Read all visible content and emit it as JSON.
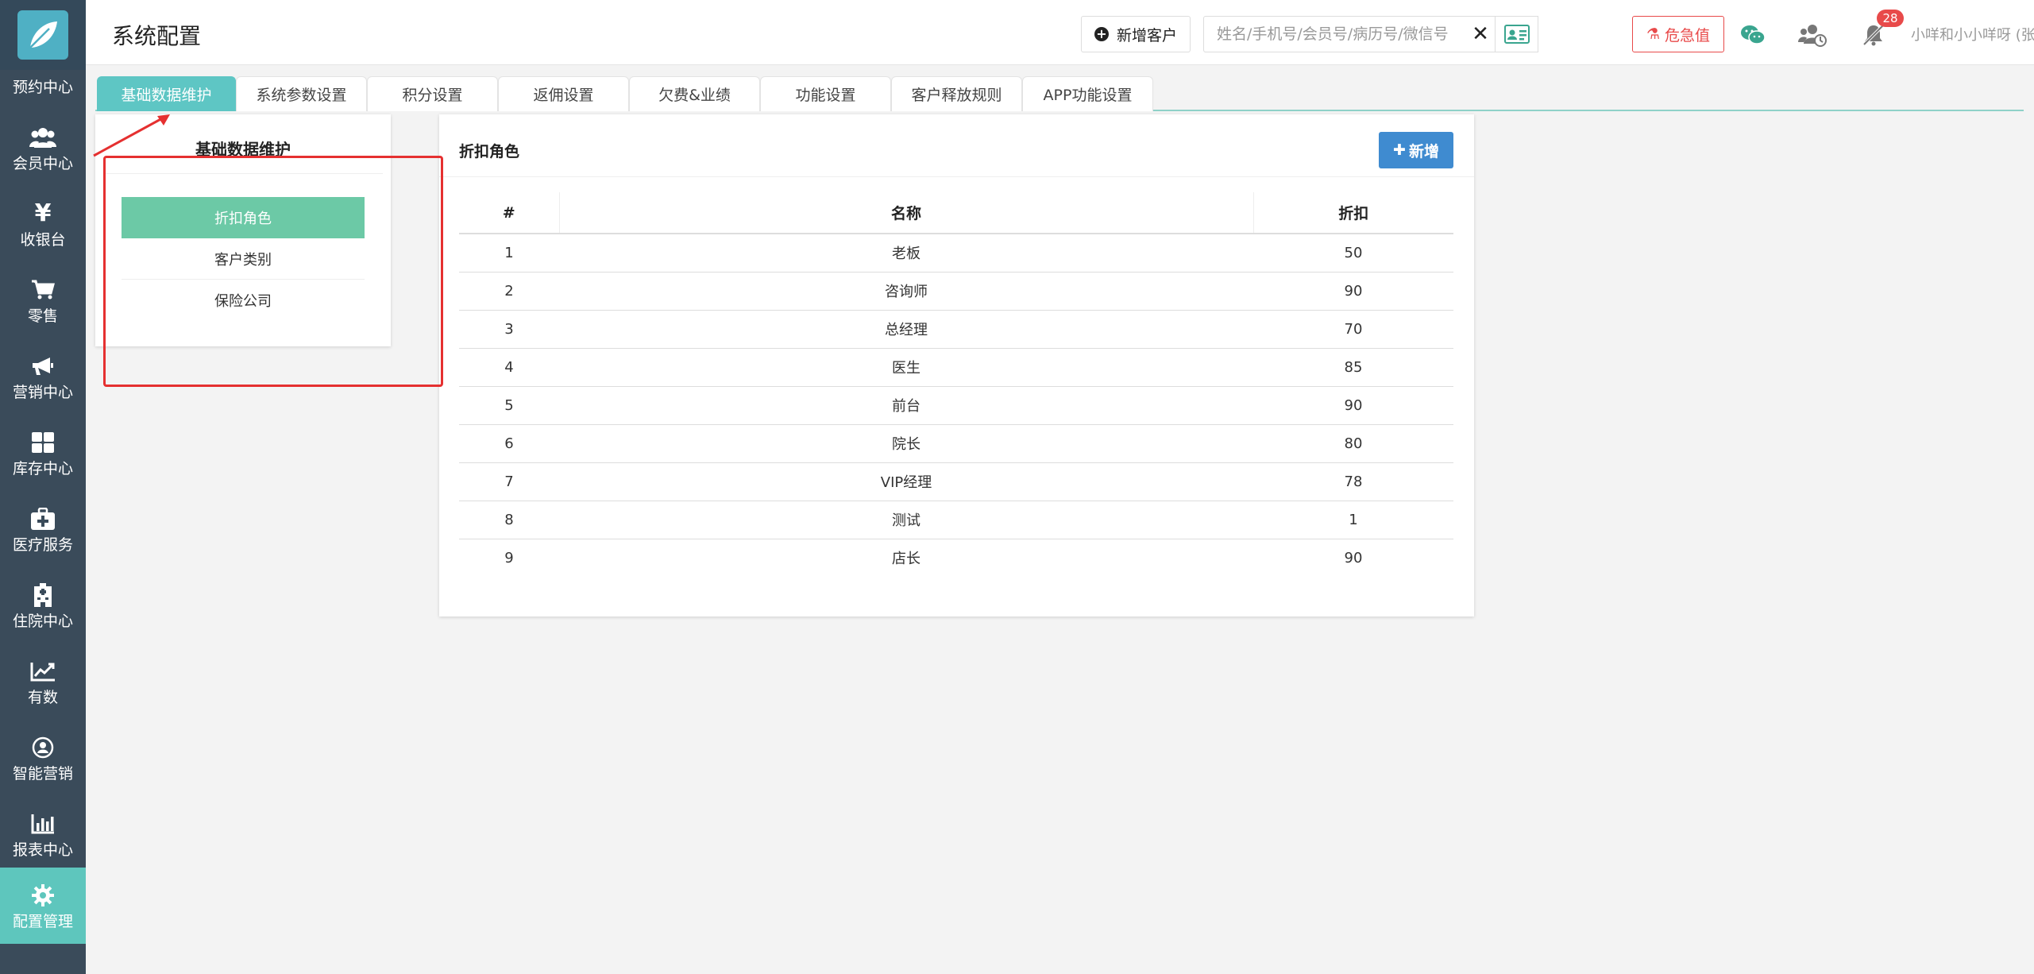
{
  "header": {
    "title": "系统配置",
    "add_customer_label": "新增客户",
    "search_placeholder": "姓名/手机号/会员号/病历号/微信号",
    "clear_icon": "close-icon",
    "danger_label": "危急值",
    "notification_count": "28",
    "user_name": "小咩和小小咩呀 (张江门诊部)"
  },
  "sidebar": {
    "partial_label": "预约中心",
    "items": [
      {
        "label": "会员中心",
        "icon": "users-icon"
      },
      {
        "label": "收银台",
        "icon": "yen-icon"
      },
      {
        "label": "零售",
        "icon": "cart-icon"
      },
      {
        "label": "营销中心",
        "icon": "megaphone-icon"
      },
      {
        "label": "库存中心",
        "icon": "grid-icon"
      },
      {
        "label": "医疗服务",
        "icon": "medkit-icon"
      },
      {
        "label": "住院中心",
        "icon": "hospital-icon"
      },
      {
        "label": "有数",
        "icon": "line-chart-icon"
      },
      {
        "label": "智能营销",
        "icon": "smart-marketing-icon"
      },
      {
        "label": "报表中心",
        "icon": "bar-chart-icon"
      },
      {
        "label": "配置管理",
        "icon": "gear-icon"
      }
    ]
  },
  "tabs": [
    {
      "label": "基础数据维护"
    },
    {
      "label": "系统参数设置"
    },
    {
      "label": "积分设置"
    },
    {
      "label": "返佣设置"
    },
    {
      "label": "欠费&业绩"
    },
    {
      "label": "功能设置"
    },
    {
      "label": "客户释放规则"
    },
    {
      "label": "APP功能设置"
    }
  ],
  "left_panel": {
    "title": "基础数据维护",
    "items": [
      {
        "label": "折扣角色"
      },
      {
        "label": "客户类别"
      },
      {
        "label": "保险公司"
      }
    ]
  },
  "right_panel": {
    "title": "折扣角色",
    "new_button_label": "新增",
    "columns": [
      "#",
      "名称",
      "折扣"
    ],
    "rows": [
      {
        "no": "1",
        "name": "老板",
        "discount": "50"
      },
      {
        "no": "2",
        "name": "咨询师",
        "discount": "90"
      },
      {
        "no": "3",
        "name": "总经理",
        "discount": "70"
      },
      {
        "no": "4",
        "name": "医生",
        "discount": "85"
      },
      {
        "no": "5",
        "name": "前台",
        "discount": "90"
      },
      {
        "no": "6",
        "name": "院长",
        "discount": "80"
      },
      {
        "no": "7",
        "name": "VIP经理",
        "discount": "78"
      },
      {
        "no": "8",
        "name": "测试",
        "discount": "1"
      },
      {
        "no": "9",
        "name": "店长",
        "discount": "90"
      }
    ]
  },
  "colors": {
    "sidebar_bg": "#3a4b5a",
    "accent": "#5ec6c4",
    "active_item": "#6cc9a6",
    "primary_button": "#3f8bd0",
    "danger": "#e84a4a",
    "highlight": "#e53030"
  }
}
